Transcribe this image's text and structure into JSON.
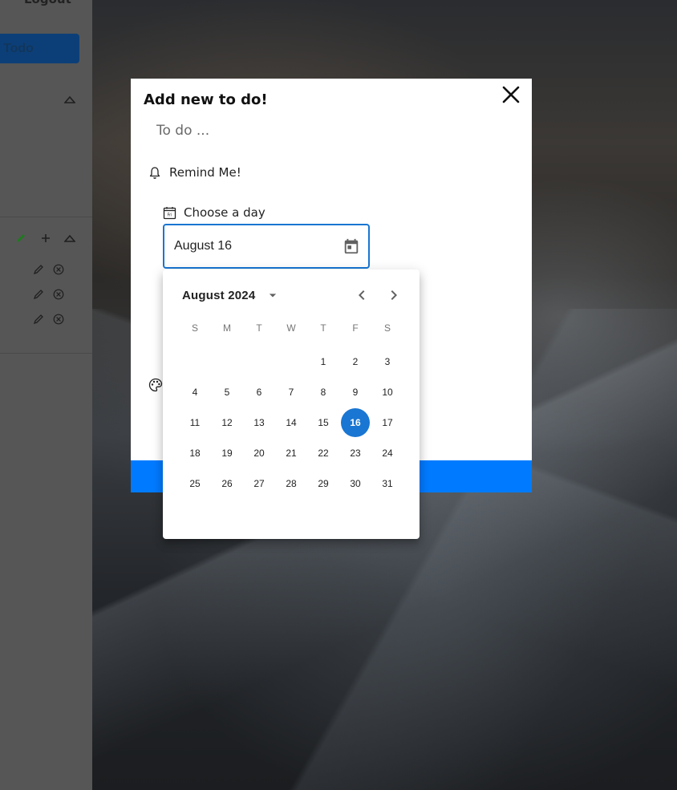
{
  "sidebar": {
    "logout_label": "Logout",
    "add_todo_label": "Todo"
  },
  "modal": {
    "title": "Add new to do!",
    "todo_placeholder": "To do ...",
    "remind_label": "Remind Me!",
    "choose_day_label": "Choose a day",
    "choose_day_icon_text": "Fri",
    "date_value": "August 16"
  },
  "calendar": {
    "month_label": "August 2024",
    "weekdays": [
      "S",
      "M",
      "T",
      "W",
      "T",
      "F",
      "S"
    ],
    "weeks": [
      [
        "",
        "",
        "",
        "",
        "1",
        "2",
        "3"
      ],
      [
        "4",
        "5",
        "6",
        "7",
        "8",
        "9",
        "10"
      ],
      [
        "11",
        "12",
        "13",
        "14",
        "15",
        "16",
        "17"
      ],
      [
        "18",
        "19",
        "20",
        "21",
        "22",
        "23",
        "24"
      ],
      [
        "25",
        "26",
        "27",
        "28",
        "29",
        "30",
        "31"
      ]
    ],
    "selected_day": "16"
  },
  "colors": {
    "accent": "#1976d2",
    "submit_bar": "#007bff",
    "sidebar_edit_active": "#1e7a1e"
  }
}
